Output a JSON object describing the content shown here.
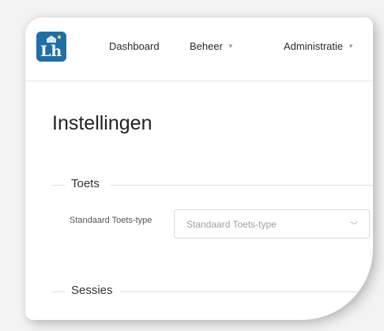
{
  "navbar": {
    "logo_text": "Lh",
    "items": [
      {
        "label": "Dashboard",
        "has_dropdown": false
      },
      {
        "label": "Beheer",
        "has_dropdown": true
      },
      {
        "label": "Administratie",
        "has_dropdown": true
      }
    ]
  },
  "page": {
    "title": "Instellingen"
  },
  "sections": {
    "toets": {
      "label": "Toets",
      "field_label": "Standaard Toets-type",
      "select_placeholder": "Standaard Toets-type"
    },
    "sessies": {
      "label": "Sessies"
    }
  },
  "colors": {
    "logo_bg": "#1d6fa8",
    "logo_letter": "#ffffff",
    "logo_accent": "#f2c84b"
  },
  "icons": {
    "caret": "caret-down-icon",
    "chevron": "chevron-down-icon"
  }
}
